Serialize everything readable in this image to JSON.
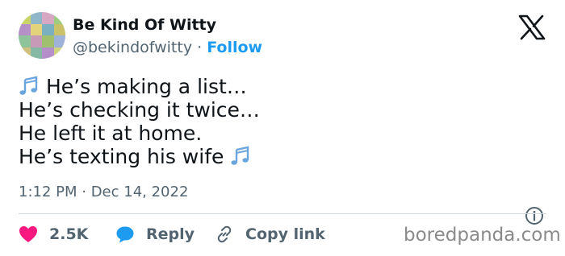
{
  "author": {
    "display_name": "Be Kind Of Witty",
    "handle": "@bekindofwitty",
    "separator": "·",
    "follow_label": "Follow"
  },
  "tweet": {
    "lines": [
      "He’s making a list…",
      "He’s checking it twice…",
      "He left it at home.",
      "He’s texting his wife"
    ],
    "timestamp": "1:12 PM · Dec 14, 2022"
  },
  "actions": {
    "like_count": "2.5K",
    "reply_label": "Reply",
    "copy_link_label": "Copy link"
  },
  "watermark": "boredpanda.com",
  "icons": {
    "platform": "x-logo-icon",
    "music": "musical-notes-icon",
    "info": "info-icon",
    "like": "heart-icon",
    "reply": "speech-bubble-icon",
    "copy": "link-icon"
  },
  "colors": {
    "text": "#0f1419",
    "secondary": "#536471",
    "accent": "#1d9bf0",
    "heart": "#f91880",
    "divider": "#cfd9de"
  }
}
